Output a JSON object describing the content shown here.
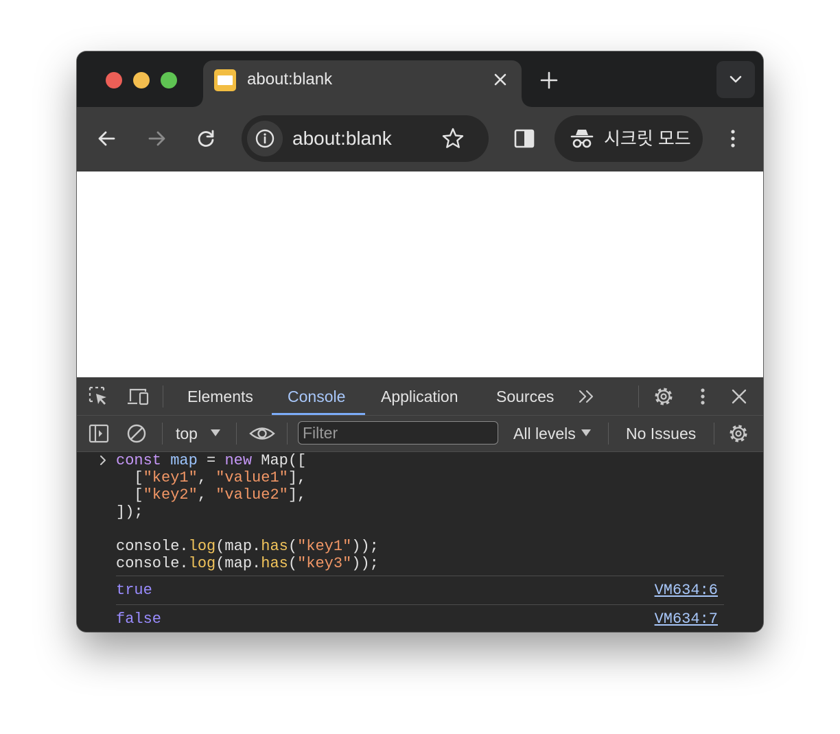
{
  "tab": {
    "title": "about:blank",
    "close_icon": "close-icon",
    "favicon_color": "#f2bd42"
  },
  "toolbar": {
    "url": "about:blank",
    "incognito_label": "시크릿 모드"
  },
  "devtools": {
    "tabs": [
      "Elements",
      "Console",
      "Application",
      "Sources"
    ],
    "active_tab": "Console",
    "console_bar": {
      "context": "top",
      "filter_placeholder": "Filter",
      "levels": "All levels",
      "issues": "No Issues"
    },
    "input_code": [
      "const map = new Map([",
      "  [\"key1\", \"value1\"],",
      "  [\"key2\", \"value2\"],",
      "]);",
      "",
      "console.log(map.has(\"key1\"));",
      "console.log(map.has(\"key3\"));"
    ],
    "outputs": [
      {
        "value": "true",
        "source": "VM634:6"
      },
      {
        "value": "false",
        "source": "VM634:7"
      }
    ]
  },
  "colors": {
    "accent": "#7cacf8",
    "keyword": "#c597f7",
    "string": "#f29766",
    "function": "#f2c45b",
    "boolean": "#9a8cff"
  }
}
